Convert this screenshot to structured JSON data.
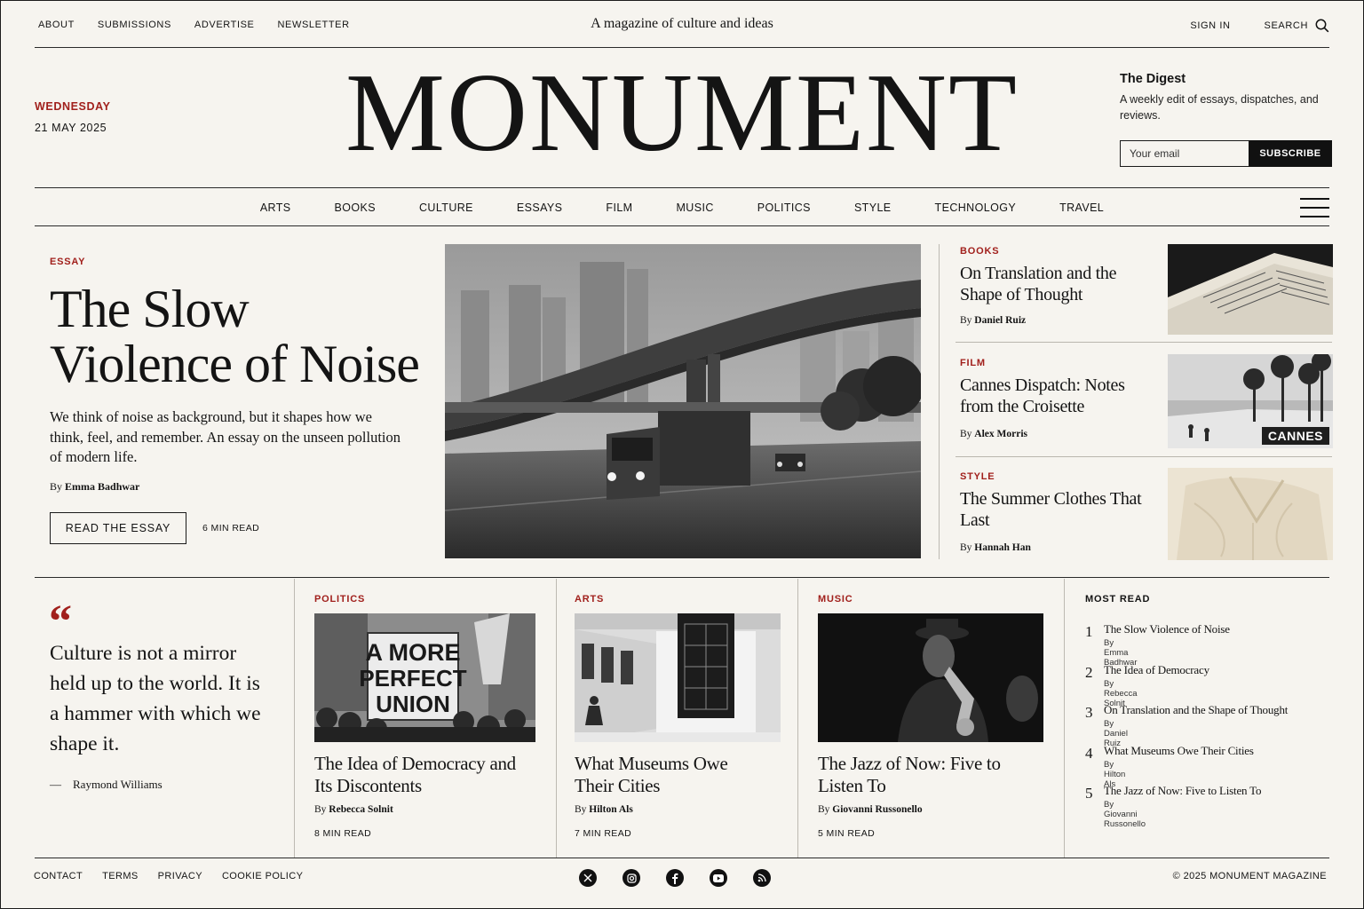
{
  "top": {
    "nav": [
      "ABOUT",
      "SUBMISSIONS",
      "ADVERTISE",
      "NEWSLETTER"
    ],
    "tagline": "A magazine of culture and ideas",
    "sign_in": "SIGN IN",
    "search": "SEARCH"
  },
  "masthead": {
    "day": "WEDNESDAY",
    "date": "21 MAY 2025",
    "logo": "MONUMENT",
    "digest": {
      "title": "The Digest",
      "description": "A weekly edit of essays, dispatches, and reviews.",
      "email_placeholder": "Your email",
      "subscribe": "SUBSCRIBE"
    }
  },
  "categories": [
    "ARTS",
    "BOOKS",
    "CULTURE",
    "ESSAYS",
    "FILM",
    "MUSIC",
    "POLITICS",
    "STYLE",
    "TECHNOLOGY",
    "TRAVEL"
  ],
  "hero": {
    "kicker": "ESSAY",
    "title": "The Slow Violence of Noise",
    "dek": "We think of noise as background, but it shapes how we think, feel, and remember. An essay on the unseen pollution of modern life.",
    "by": "By",
    "author": "Emma Badhwar",
    "cta": "READ THE ESSAY",
    "read_time": "6 MIN READ"
  },
  "side_stories": [
    {
      "kicker": "BOOKS",
      "title": "On Translation and the Shape of Thought",
      "by": "By",
      "author": "Daniel Ruiz"
    },
    {
      "kicker": "FILM",
      "title": "Cannes Dispatch: Notes from the Croisette",
      "by": "By",
      "author": "Alex Morris",
      "image_label": "CANNES"
    },
    {
      "kicker": "STYLE",
      "title": "The Summer Clothes That Last",
      "by": "By",
      "author": "Hannah Han"
    }
  ],
  "quote": {
    "mark": "“",
    "text": "Culture is not a mirror held up to the world. It is a hammer with which we shape it.",
    "dash": "—",
    "author": "Raymond Williams"
  },
  "cards": [
    {
      "kicker": "POLITICS",
      "title": "The Idea of Democracy and Its Discontents",
      "by": "By",
      "author": "Rebecca Solnit",
      "read_time": "8 MIN READ",
      "sign": [
        "A MORE",
        "PERFECT",
        "UNION"
      ]
    },
    {
      "kicker": "ARTS",
      "title": "What Museums Owe Their Cities",
      "by": "By",
      "author": "Hilton Als",
      "read_time": "7 MIN READ"
    },
    {
      "kicker": "MUSIC",
      "title": "The Jazz of Now: Five to Listen To",
      "by": "By",
      "author": "Giovanni Russonello",
      "read_time": "5 MIN READ"
    }
  ],
  "most_read": {
    "title": "MOST READ",
    "items": [
      {
        "n": "1",
        "title": "The Slow Violence of Noise",
        "author": "By Emma Badhwar"
      },
      {
        "n": "2",
        "title": "The Idea of Democracy",
        "author": "By Rebecca Solnit"
      },
      {
        "n": "3",
        "title": "On Translation and the Shape of Thought",
        "author": "By Daniel Ruiz"
      },
      {
        "n": "4",
        "title": "What Museums Owe Their Cities",
        "author": "By Hilton Als"
      },
      {
        "n": "5",
        "title": "The Jazz of Now: Five to Listen To",
        "author": "By Giovanni Russonello"
      }
    ]
  },
  "footer": {
    "links": [
      "CONTACT",
      "TERMS",
      "PRIVACY",
      "COOKIE POLICY"
    ],
    "social_icons": [
      "x-icon",
      "instagram-icon",
      "facebook-icon",
      "youtube-icon",
      "rss-icon"
    ],
    "copyright": "© 2025 MONUMENT MAGAZINE"
  },
  "colors": {
    "accent": "#a1201c",
    "background": "#f6f4ef",
    "ink": "#141414"
  }
}
